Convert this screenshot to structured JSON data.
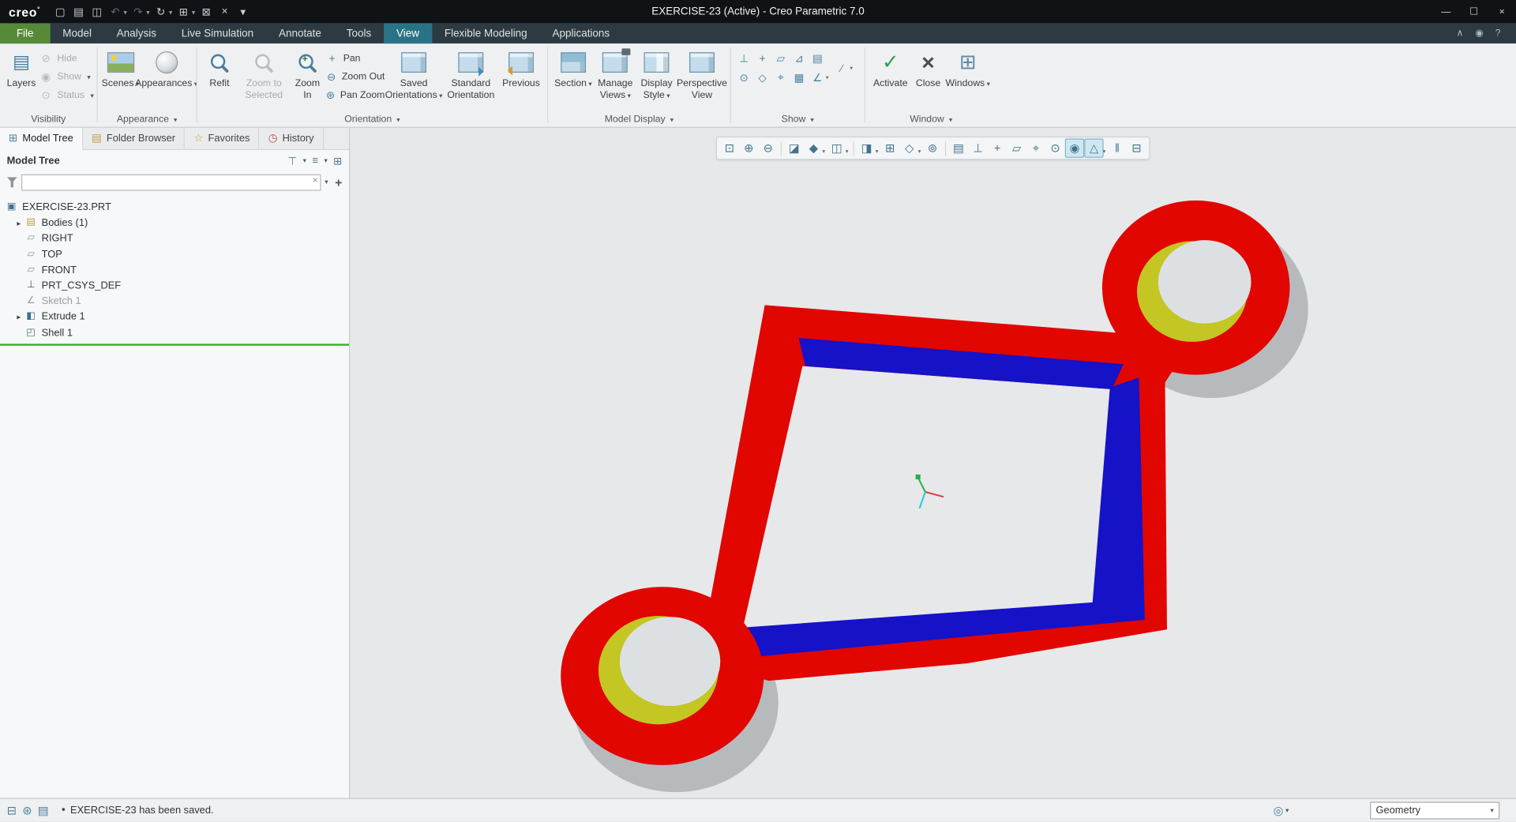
{
  "colors": {
    "model_red": "#e10600",
    "model_blue": "#1512c8",
    "model_yellow": "#c3c623",
    "model_gray": "#b7babd",
    "hole_bg": "#dde0e2",
    "canvas_bg": "#e6e8ea",
    "triad_red": "#e03c3c",
    "triad_green": "#25b04a",
    "triad_cyan": "#1fc8dc",
    "file_tab_green": "#568a38",
    "active_tab_teal": "#2a7387",
    "insert_line_green": "#3fae2a"
  },
  "icons": {
    "caret": "▾",
    "tree_arrow": "▸",
    "layers_glyph": "▤",
    "hide_glyph": "⊘",
    "show_glyph": "◉",
    "status_glyph": "⊙",
    "pan_glyph": "+",
    "zoom_out_glyph": "⊖",
    "pan_zoom_glyph": "⊛",
    "activate_glyph": "✓",
    "close_glyph": "×",
    "windows_glyph": "⊞",
    "mag_plus": "+",
    "clear_glyph": "×",
    "plus_glyph": "+",
    "logo_mark": "°",
    "bullet": "●",
    "find_glyph": "◎"
  },
  "title_bar": {
    "logo_text": "creo",
    "app_title": "EXERCISE-23 (Active) - Creo Parametric 7.0",
    "qat_icons": [
      {
        "name": "new-file-icon",
        "glyph": "▢"
      },
      {
        "name": "open-file-icon",
        "glyph": "▤"
      },
      {
        "name": "save-icon",
        "glyph": "◫"
      },
      {
        "name": "undo-icon",
        "glyph": "↶",
        "dim": true,
        "dd": true
      },
      {
        "name": "redo-icon",
        "glyph": "↷",
        "dim": true,
        "dd": true
      },
      {
        "name": "regenerate-icon",
        "glyph": "↻",
        "dd": true
      },
      {
        "name": "window-settings-icon",
        "glyph": "⊞",
        "dd": true
      },
      {
        "name": "mail-icon",
        "glyph": "⊠"
      },
      {
        "name": "close-window-icon",
        "glyph": "×"
      },
      {
        "name": "customize-qat-icon",
        "glyph": "▾"
      }
    ],
    "window_controls": [
      {
        "name": "minimize-button",
        "glyph": "—"
      },
      {
        "name": "maximize-button",
        "glyph": "☐"
      },
      {
        "name": "close-button",
        "glyph": "×"
      }
    ]
  },
  "tab_bar": {
    "tabs": [
      {
        "label": "File",
        "kind": "file"
      },
      {
        "label": "Model"
      },
      {
        "label": "Analysis"
      },
      {
        "label": "Live Simulation"
      },
      {
        "label": "Annotate"
      },
      {
        "label": "Tools"
      },
      {
        "label": "View",
        "kind": "active"
      },
      {
        "label": "Flexible Modeling"
      },
      {
        "label": "Applications"
      }
    ],
    "right_icons": [
      {
        "name": "minimize-ribbon-icon",
        "glyph": "∧"
      },
      {
        "name": "presence-icon",
        "glyph": "◉"
      },
      {
        "name": "help-icon",
        "glyph": "?"
      }
    ]
  },
  "ribbon": {
    "visibility": {
      "group_label": "Visibility",
      "layers": "Layers",
      "hide": "Hide",
      "show": "Show",
      "status": "Status"
    },
    "appearance": {
      "group_label": "Appearance",
      "scenes": "Scenes",
      "appearances": "Appearances"
    },
    "orientation": {
      "group_label": "Orientation",
      "refit": "Refit",
      "zoom_to_selected": "Zoom to Selected",
      "zoom_in": "Zoom In",
      "pan": "Pan",
      "zoom_out": "Zoom Out",
      "pan_zoom": "Pan Zoom",
      "saved_orientations": "Saved Orientations",
      "standard_orientation": "Standard Orientation",
      "previous": "Previous"
    },
    "model_display": {
      "group_label": "Model Display",
      "section": "Section",
      "manage_views": "Manage Views",
      "display_style": "Display Style",
      "perspective_view": "Perspective View"
    },
    "show": {
      "group_label": "Show",
      "row1": [
        {
          "name": "datum-axis-display-icon",
          "glyph": "⊥"
        },
        {
          "name": "datum-point-display-icon",
          "glyph": "+"
        },
        {
          "name": "datum-plane-display-icon",
          "glyph": "▱"
        },
        {
          "name": "csys-display-icon",
          "glyph": "⊿"
        },
        {
          "name": "annotation-display-icon",
          "glyph": "▤"
        }
      ],
      "row2": [
        {
          "name": "spin-center-display-icon",
          "glyph": "⊙"
        },
        {
          "name": "point-symbol-icon",
          "glyph": "◇"
        },
        {
          "name": "tolerance-display-icon",
          "glyph": "⌖"
        },
        {
          "name": "names-display-icon",
          "glyph": "▦"
        },
        {
          "name": "silhouette-display-icon",
          "glyph": "∠",
          "dd": true
        }
      ],
      "extra": {
        "name": "section-hatch-icon",
        "glyph": "∕",
        "dd": true
      }
    },
    "window": {
      "group_label": "Window",
      "activate": "Activate",
      "close": "Close",
      "windows": "Windows"
    }
  },
  "left_panel": {
    "nav_tabs": [
      {
        "label": "Model Tree",
        "icon": "model-tree-tab-icon",
        "glyph": "⊞",
        "cls": "nt-modeltree",
        "active": true
      },
      {
        "label": "Folder Browser",
        "icon": "folder-browser-tab-icon",
        "glyph": "▤",
        "cls": "nt-folder"
      },
      {
        "label": "Favorites",
        "icon": "favorites-tab-icon",
        "glyph": "☆",
        "cls": "nt-fav"
      },
      {
        "label": "History",
        "icon": "history-tab-icon",
        "glyph": "◷",
        "cls": "nt-history"
      }
    ],
    "tree_title": "Model Tree",
    "header_icons": [
      {
        "name": "tree-filters-icon",
        "glyph": "⊤",
        "dd": true
      },
      {
        "name": "tree-settings-icon",
        "glyph": "≡",
        "dd": true
      },
      {
        "name": "tree-columns-icon",
        "glyph": "⊞"
      }
    ],
    "tree_icon_glyphs": {
      "part": "▣",
      "bodies": "▤",
      "plane": "▱",
      "csys": "⊥",
      "sketch": "∠",
      "extrude": "◧",
      "shell": "◰"
    },
    "tree_items": [
      {
        "label": "EXERCISE-23.PRT",
        "icon": "part",
        "indent": 0
      },
      {
        "label": "Bodies (1)",
        "icon": "bodies",
        "indent": 1,
        "arrow": true
      },
      {
        "label": "RIGHT",
        "icon": "plane",
        "indent": 1
      },
      {
        "label": "TOP",
        "icon": "plane",
        "indent": 1
      },
      {
        "label": "FRONT",
        "icon": "plane",
        "indent": 1
      },
      {
        "label": "PRT_CSYS_DEF",
        "icon": "csys",
        "indent": 1
      },
      {
        "label": "Sketch 1",
        "icon": "sketch",
        "indent": 1,
        "dim": true
      },
      {
        "label": "Extrude 1",
        "icon": "extrude",
        "indent": 1,
        "arrow": true
      },
      {
        "label": "Shell 1",
        "icon": "shell",
        "indent": 1
      }
    ]
  },
  "graphics_toolbar": {
    "icons": [
      {
        "name": "refit-icon",
        "glyph": "⊡"
      },
      {
        "name": "zoom-in-icon",
        "glyph": "⊕"
      },
      {
        "name": "zoom-out-icon",
        "glyph": "⊖"
      },
      {
        "sep": true
      },
      {
        "name": "repaint-icon",
        "glyph": "◪"
      },
      {
        "name": "shade-icon",
        "glyph": "◆",
        "dd": true
      },
      {
        "name": "display-style-icon",
        "glyph": "◫",
        "dd": true
      },
      {
        "sep": true
      },
      {
        "name": "show-section-icon",
        "glyph": "◨",
        "dd": true
      },
      {
        "name": "capture-icon",
        "glyph": "⊞"
      },
      {
        "name": "named-views-icon",
        "glyph": "◇",
        "dd": true
      },
      {
        "name": "view-normal-icon",
        "glyph": "⊚"
      },
      {
        "sep": true
      },
      {
        "name": "annotation-display-icon",
        "glyph": "▤"
      },
      {
        "name": "datum-axis-display-icon",
        "glyph": "⊥"
      },
      {
        "name": "datum-point-display-icon",
        "glyph": "+"
      },
      {
        "name": "datum-plane-display-icon",
        "glyph": "▱"
      },
      {
        "name": "csys-display-icon",
        "glyph": "⌖"
      },
      {
        "name": "spin-center-icon",
        "glyph": "⊙"
      },
      {
        "name": "graphics-toggle-icon",
        "glyph": "◉",
        "active": true
      },
      {
        "name": "realtime-sim-icon",
        "glyph": "△",
        "active": true,
        "dd": true
      },
      {
        "name": "sim-pause-icon",
        "glyph": "‖"
      },
      {
        "name": "sim-stop-icon",
        "glyph": "⊟"
      }
    ]
  },
  "status_bar": {
    "left_icons": [
      {
        "name": "model-tree-toggle-icon",
        "glyph": "⊟"
      },
      {
        "name": "web-browser-icon",
        "glyph": "⊛"
      },
      {
        "name": "console-icon",
        "glyph": "▤"
      }
    ],
    "message": "EXERCISE-23 has been saved.",
    "filter_value": "Geometry"
  }
}
